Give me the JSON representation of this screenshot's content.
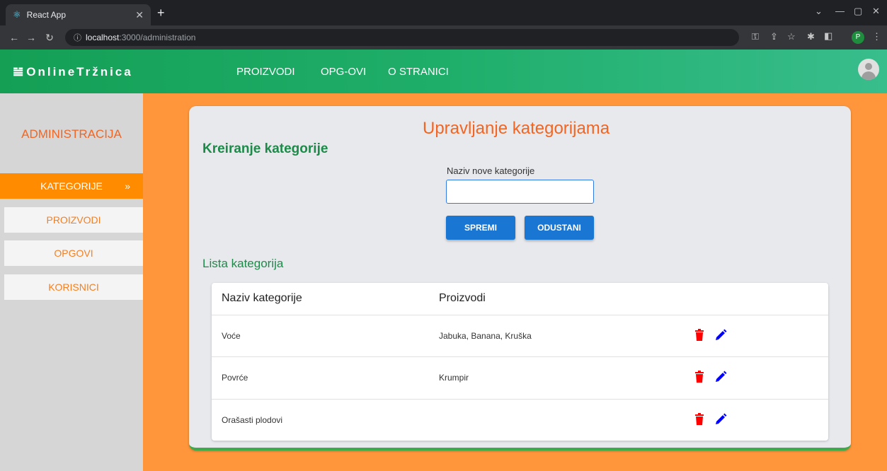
{
  "browser": {
    "tab_title": "React App",
    "url_host": "localhost",
    "url_path": ":3000/administration",
    "profile_initial": "P"
  },
  "header": {
    "logo_text": "OnlineTržnica",
    "nav": [
      {
        "label": "PROIZVODI"
      },
      {
        "label": "OPG-OVI"
      },
      {
        "label": "O STRANICI"
      }
    ]
  },
  "sidebar": {
    "title": "ADMINISTRACIJA",
    "items": [
      {
        "label": "KATEGORIJE",
        "active": true
      },
      {
        "label": "PROIZVODI"
      },
      {
        "label": "OPGOVI"
      },
      {
        "label": "KORISNICI"
      }
    ]
  },
  "main": {
    "title": "Upravljanje kategorijama",
    "create_heading": "Kreiranje kategorije",
    "input_label": "Naziv nove kategorije",
    "input_value": "",
    "save_label": "SPREMI",
    "cancel_label": "ODUSTANI",
    "list_heading": "Lista kategorija",
    "table": {
      "headers": [
        "Naziv kategorije",
        "Proizvodi"
      ],
      "rows": [
        {
          "name": "Voće",
          "products": "Jabuka, Banana, Kruška"
        },
        {
          "name": "Povrće",
          "products": "Krumpir"
        },
        {
          "name": "Orašasti plodovi",
          "products": ""
        }
      ]
    }
  },
  "colors": {
    "header_green": "#1fae6a",
    "accent_orange": "#ff8c00",
    "title_orange": "#f26522",
    "heading_green": "#1e8a4a",
    "button_blue": "#1976d2",
    "delete_red": "#ff0000",
    "edit_blue": "#0000ff"
  },
  "icons": {
    "delete": "trash-icon",
    "edit": "pencil-icon"
  }
}
